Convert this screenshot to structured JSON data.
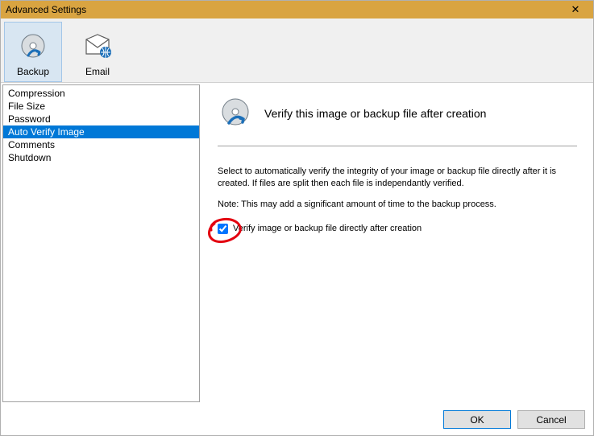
{
  "window": {
    "title": "Advanced Settings"
  },
  "toolbar": {
    "items": [
      {
        "label": "Backup",
        "active": true
      },
      {
        "label": "Email",
        "active": false
      }
    ]
  },
  "sidebar": {
    "items": [
      {
        "label": "Compression",
        "selected": false
      },
      {
        "label": "File Size",
        "selected": false
      },
      {
        "label": "Password",
        "selected": false
      },
      {
        "label": "Auto Verify Image",
        "selected": true
      },
      {
        "label": "Comments",
        "selected": false
      },
      {
        "label": "Shutdown",
        "selected": false
      }
    ]
  },
  "main": {
    "heading": "Verify this image or backup file after creation",
    "description": "Select to automatically verify the integrity of your image or backup file directly after it is created. If files are split then each file is independantly verified.",
    "note": "Note: This may add a significant amount of time to the backup process.",
    "checkbox_label": "Verify image or backup file directly after creation",
    "checkbox_checked": true
  },
  "buttons": {
    "ok": "OK",
    "cancel": "Cancel"
  }
}
